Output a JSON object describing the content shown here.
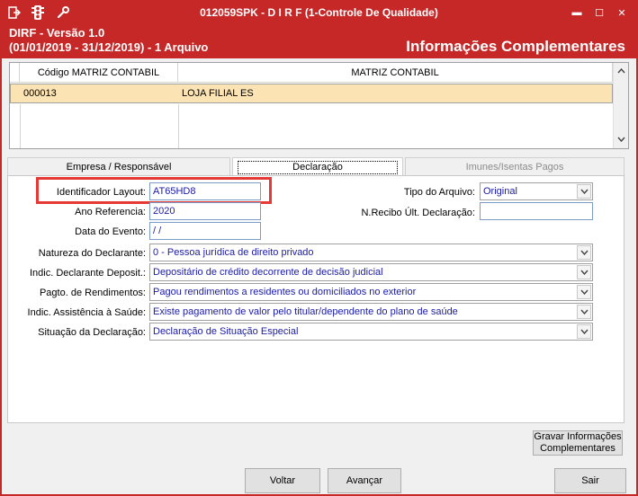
{
  "titlebar": {
    "title": "012059SPK - D I R F (1-Controle De Qualidade)",
    "icons": [
      "exit-icon",
      "traffic-light-icon",
      "wrench-icon"
    ],
    "controls": {
      "minimize": "▬",
      "maximize": "☐",
      "close": "✕"
    }
  },
  "header": {
    "line1": "DIRF - Versão 1.0",
    "line2": "(01/01/2019 - 31/12/2019) - 1 Arquivo",
    "right": "Informações Complementares"
  },
  "grid": {
    "columns": [
      "Código MATRIZ CONTABIL",
      "MATRIZ CONTABIL"
    ],
    "rows": [
      {
        "codigo": "000013",
        "matriz": "LOJA FILIAL ES"
      }
    ]
  },
  "tabs": [
    {
      "label": "Empresa / Responsável",
      "state": "normal"
    },
    {
      "label": "Declaração",
      "state": "active"
    },
    {
      "label": "Imunes/Isentas Pagos",
      "state": "disabled"
    }
  ],
  "form": {
    "identificador": {
      "label": "Identificador Layout:",
      "value": "AT65HD8"
    },
    "ano": {
      "label": "Ano Referencia:",
      "value": "2020"
    },
    "data_evento": {
      "label": "Data do Evento:",
      "value": " / /"
    },
    "tipo_arquivo": {
      "label": "Tipo do Arquivo:",
      "value": "Original"
    },
    "recibo": {
      "label": "N.Recibo Últ. Declaração:",
      "value": ""
    },
    "natureza": {
      "label": "Natureza do Declarante:",
      "value": "0 - Pessoa jurídica de direito privado"
    },
    "indic_deposit": {
      "label": "Indic. Declarante Deposit.:",
      "value": "Depositário de crédito decorrente de decisão judicial"
    },
    "pagto": {
      "label": "Pagto. de Rendimentos:",
      "value": "Pagou rendimentos a residentes ou domiciliados no exterior"
    },
    "assistencia": {
      "label": "Indic. Assistência à Saúde:",
      "value": "Existe pagamento de valor pelo titular/dependente do plano de saúde"
    },
    "situacao": {
      "label": "Situação da Declaração:",
      "value": "Declaração de Situação Especial"
    }
  },
  "buttons": {
    "gravar_line1": "Gravar Informações",
    "gravar_line2": "Complementares",
    "voltar": "Voltar",
    "avancar": "Avançar",
    "sair": "Sair"
  },
  "colors": {
    "title_bar": "#c62828",
    "selected_row": "#fbe3b4",
    "field_text": "#1a1aa8",
    "highlight": "#e53935"
  }
}
